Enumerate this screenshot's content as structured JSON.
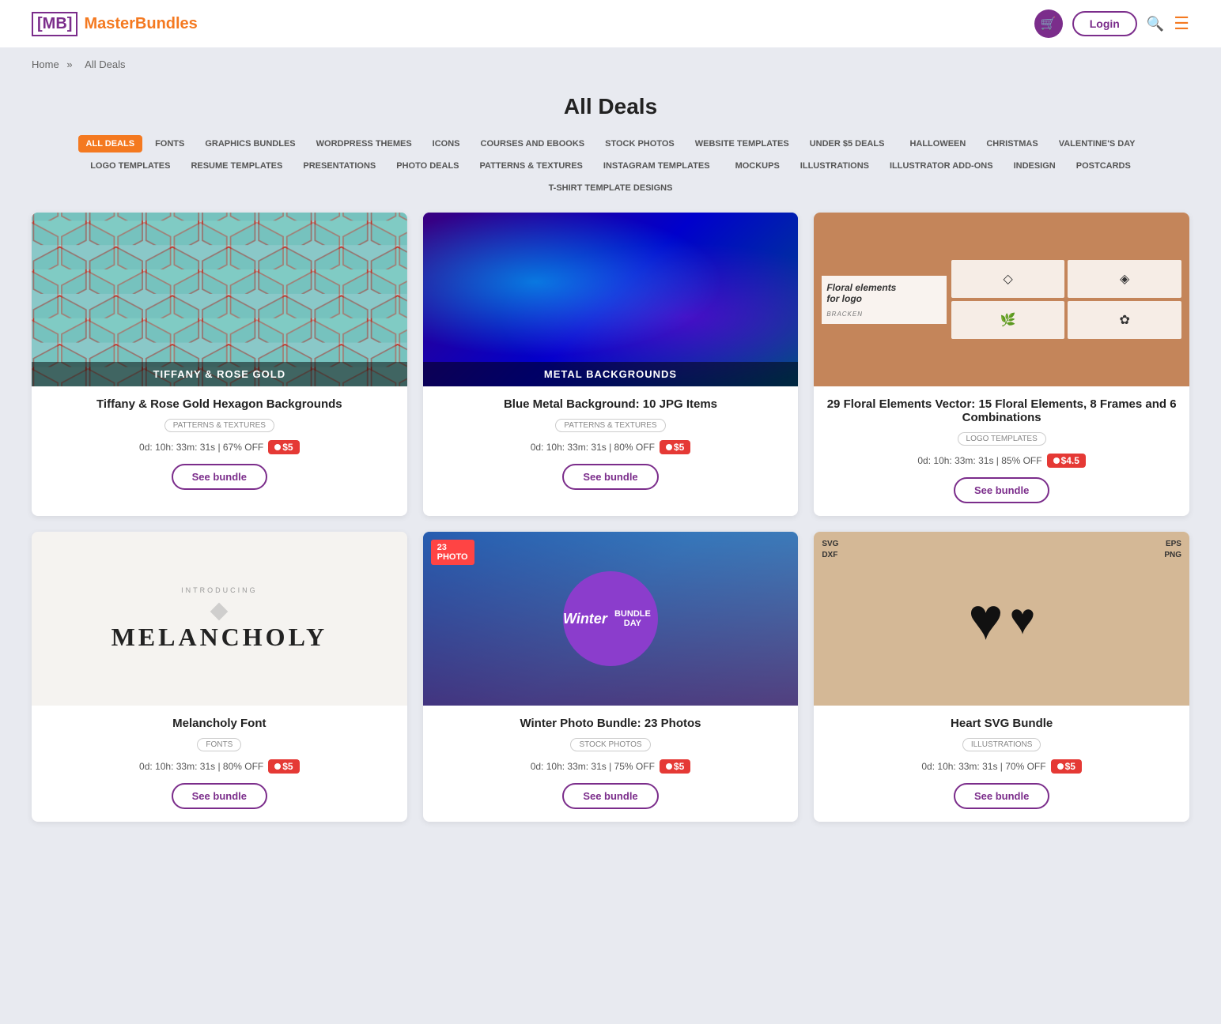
{
  "header": {
    "logo_bracket": "[MB]",
    "logo_text": "MasterBundles",
    "cart_icon": "🛒",
    "login_label": "Login",
    "search_icon": "🔍",
    "menu_icon": "☰"
  },
  "breadcrumb": {
    "home": "Home",
    "separator": "»",
    "current": "All Deals"
  },
  "page": {
    "title": "All Deals"
  },
  "nav_tags": [
    {
      "label": "ALL DEALS",
      "active": true
    },
    {
      "label": "FONTS",
      "active": false
    },
    {
      "label": "GRAPHICS BUNDLES",
      "active": false
    },
    {
      "label": "WORDPRESS THEMES",
      "active": false
    },
    {
      "label": "ICONS",
      "active": false
    },
    {
      "label": "COURSES AND EBOOKS",
      "active": false
    },
    {
      "label": "STOCK PHOTOS",
      "active": false
    },
    {
      "label": "WEBSITE TEMPLATES",
      "active": false
    },
    {
      "label": "UNDER $5 DEALS",
      "active": false
    },
    {
      "label": "HALLOWEEN",
      "active": false
    },
    {
      "label": "CHRISTMAS",
      "active": false
    },
    {
      "label": "VALENTINE'S DAY",
      "active": false
    },
    {
      "label": "LOGO TEMPLATES",
      "active": false
    },
    {
      "label": "RESUME TEMPLATES",
      "active": false
    },
    {
      "label": "PRESENTATIONS",
      "active": false
    },
    {
      "label": "PHOTO DEALS",
      "active": false
    },
    {
      "label": "PATTERNS & TEXTURES",
      "active": false
    },
    {
      "label": "INSTAGRAM TEMPLATES",
      "active": false
    },
    {
      "label": "MOCKUPS",
      "active": false
    },
    {
      "label": "ILLUSTRATIONS",
      "active": false
    },
    {
      "label": "ILLUSTRATOR ADD-ONS",
      "active": false
    },
    {
      "label": "INDESIGN",
      "active": false
    },
    {
      "label": "POSTCARDS",
      "active": false
    },
    {
      "label": "T-SHIRT TEMPLATE DESIGNS",
      "active": false
    }
  ],
  "products": [
    {
      "id": 1,
      "title": "Tiffany & Rose Gold Hexagon Backgrounds",
      "image_label": "TIFFANY & ROSE GOLD",
      "image_type": "hexagon",
      "category": "PATTERNS & TEXTURES",
      "timer": "0d: 10h: 33m: 31s",
      "discount": "67% OFF",
      "price": "$5",
      "btn_label": "See bundle"
    },
    {
      "id": 2,
      "title": "Blue Metal Background: 10 JPG Items",
      "image_label": "METAL BACKGROUNDS",
      "image_type": "metal",
      "category": "PATTERNS & TEXTURES",
      "timer": "0d: 10h: 33m: 31s",
      "discount": "80% OFF",
      "price": "$5",
      "btn_label": "See bundle"
    },
    {
      "id": 3,
      "title": "29 Floral Elements Vector: 15 Floral Elements, 8 Frames and 6 Combinations",
      "image_label": "Floral elements for logo",
      "image_type": "floral",
      "category": "LOGO TEMPLATES",
      "timer": "0d: 10h: 33m: 31s",
      "discount": "85% OFF",
      "price": "$4.5",
      "btn_label": "See bundle"
    },
    {
      "id": 4,
      "title": "Melancholy Font",
      "image_label": "MELANCHOLY",
      "image_type": "font",
      "category": "FONTS",
      "timer": "0d: 10h: 33m: 31s",
      "discount": "80% OFF",
      "price": "$5",
      "btn_label": "See bundle"
    },
    {
      "id": 5,
      "title": "Winter Photo Bundle: 23 Photos",
      "image_label": "Winter",
      "image_type": "winter",
      "category": "STOCK PHOTOS",
      "timer": "0d: 10h: 33m: 31s",
      "discount": "75% OFF",
      "price": "$5",
      "btn_label": "See bundle"
    },
    {
      "id": 6,
      "title": "Heart SVG Bundle",
      "image_label": "SVG DXF EPS PNG",
      "image_type": "hearts",
      "category": "ILLUSTRATIONS",
      "timer": "0d: 10h: 33m: 31s",
      "discount": "70% OFF",
      "price": "$5",
      "btn_label": "See bundle"
    }
  ]
}
